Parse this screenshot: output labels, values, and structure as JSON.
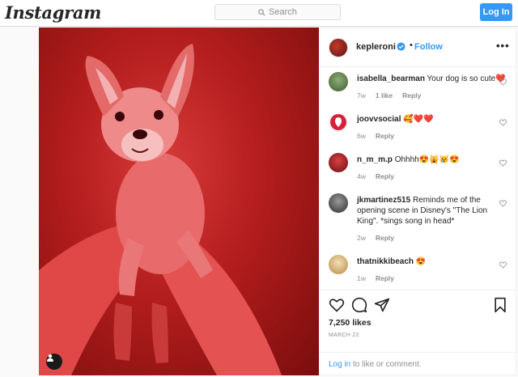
{
  "topbar": {
    "logo": "Instagram",
    "search_placeholder": "Search",
    "login_label": "Log In"
  },
  "post": {
    "username": "kepleroni",
    "dot": "•",
    "follow_label": "Follow",
    "more": "•••",
    "likes": "7,250 likes",
    "date": "MARCH 22",
    "login_link": "Log in",
    "login_suffix": " to like or comment."
  },
  "comments": [
    {
      "user": "isabella_bearman",
      "text": "Your dog is so cute❤️",
      "age": "7w",
      "likes": "1 like",
      "reply": "Reply"
    },
    {
      "user": "joovvsocial",
      "text": "🥰❤️❤️",
      "age": "6w",
      "likes": "",
      "reply": "Reply"
    },
    {
      "user": "n_m_m.p",
      "text": "Ohhhh😍🙀😿😍",
      "age": "4w",
      "likes": "",
      "reply": "Reply"
    },
    {
      "user": "jkmartinez515",
      "text": "Reminds me of the opening scene in Disney's \"The Lion King\". *sings song in head*",
      "age": "2w",
      "likes": "",
      "reply": "Reply"
    },
    {
      "user": "thatnikkibeach",
      "text": "😍",
      "age": "1w",
      "likes": "",
      "reply": "Reply"
    }
  ],
  "colors": {
    "accent": "#3897f0",
    "photo_red": "#c42424"
  },
  "icons": [
    "search-icon",
    "verified-icon",
    "more-icon",
    "heart-icon",
    "comment-icon",
    "share-icon",
    "bookmark-icon",
    "user-tag-icon"
  ]
}
